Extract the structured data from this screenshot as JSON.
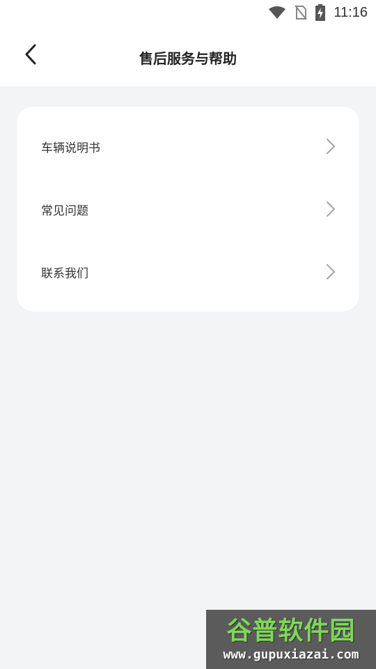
{
  "status_bar": {
    "time": "11:16",
    "icons": [
      "wifi-icon",
      "no-sim-icon",
      "battery-charging-icon"
    ]
  },
  "header": {
    "title": "售后服务与帮助",
    "back_icon": "chevron-left-icon"
  },
  "menu": {
    "items": [
      {
        "label": "车辆说明书",
        "icon": "chevron-right-icon"
      },
      {
        "label": "常见问题",
        "icon": "chevron-right-icon"
      },
      {
        "label": "联系我们",
        "icon": "chevron-right-icon"
      }
    ]
  },
  "watermark": {
    "logo_text": "谷普软件园",
    "url": "www.gupuxiazai.com"
  },
  "colors": {
    "page_background": "#f3f4f6",
    "card_background": "#ffffff",
    "chevron": "#a0a4ab",
    "title_text": "#222222"
  }
}
